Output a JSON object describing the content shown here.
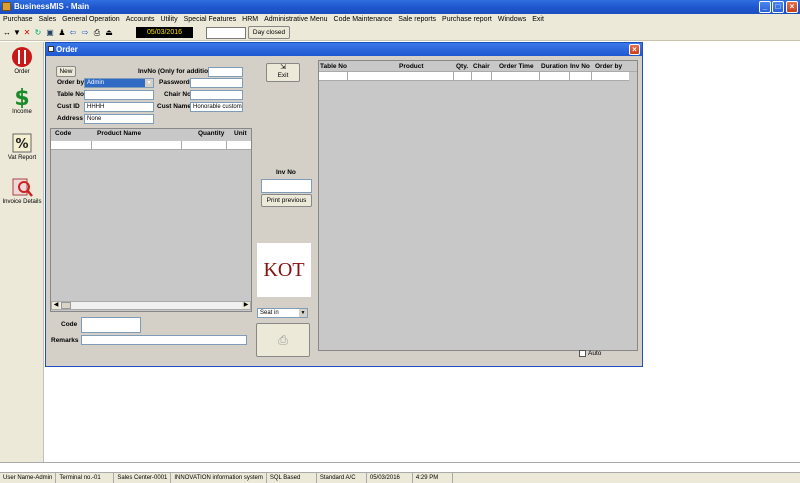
{
  "window": {
    "title": "BusinessMIS - Main"
  },
  "menu": [
    "Purchase",
    "Sales",
    "General Operation",
    "Accounts",
    "Utility",
    "Special Features",
    "HRM",
    "Administrative Menu",
    "Code Maintenance",
    "Sale reports",
    "Purchase report",
    "Windows",
    "Exit"
  ],
  "toolbar": {
    "date": "05/03/2016",
    "day_closed_label": "Day closed"
  },
  "left_panel": [
    {
      "label": "Order",
      "icon": "fork-knife-icon"
    },
    {
      "label": "Income",
      "icon": "dollar-icon"
    },
    {
      "label": "Vat Report",
      "icon": "percent-icon"
    },
    {
      "label": "Invoice Details",
      "icon": "magnifier-icon"
    }
  ],
  "order": {
    "title": "Order",
    "new_label": "New",
    "exit_label": "Exit",
    "invno_label": "InvNo (Only for addition)",
    "order_by_label": "Order by",
    "order_by_value": "Admin",
    "password_label": "Password",
    "table_no_label": "Table No",
    "chair_no_label": "Chair No",
    "cust_id_label": "Cust ID",
    "cust_id_value": "HHHH",
    "cust_name_label": "Cust Name",
    "cust_name_value": "Honorable customer",
    "address_label": "Address",
    "address_value": "None",
    "items_columns": [
      "Code",
      "Product Name",
      "Quantity",
      "Unit"
    ],
    "code_label": "Code",
    "remarks_label": "Remarks",
    "inv_no_label": "Inv No",
    "print_previous_label": "Print previous",
    "kot_label": "KOT",
    "seat_value": "Seat in",
    "orders_columns": [
      "Table No",
      "Product",
      "Qty.",
      "Chair",
      "Order Time",
      "Duration",
      "Inv No",
      "Order by"
    ],
    "auto_label": "Auto"
  },
  "status": [
    "User Name-Admin",
    "Terminal no.-01",
    "Sales Center-0001",
    "INNOVATION information system",
    "SQL Based",
    "Standard A/C",
    "05/03/2016",
    "4:29 PM"
  ]
}
